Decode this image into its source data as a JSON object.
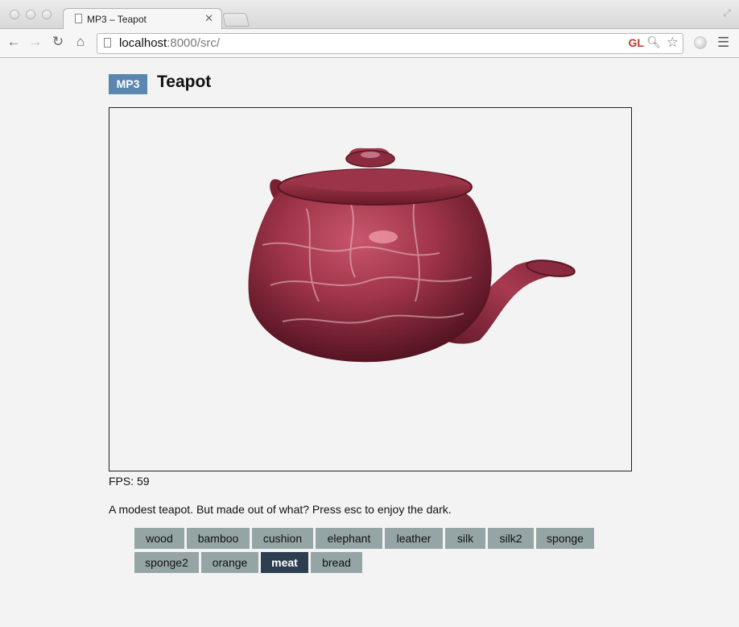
{
  "browser": {
    "tab_title": "MP3 – Teapot",
    "url_host": "localhost",
    "url_rest": ":8000/src/",
    "extension_badge": "GL"
  },
  "page": {
    "logo": "MP3",
    "title": "Teapot",
    "fps_label": "FPS: 59",
    "description": "A modest teapot. But made out of what? Press esc to enjoy the dark."
  },
  "materials": {
    "items": [
      "wood",
      "bamboo",
      "cushion",
      "elephant",
      "leather",
      "silk",
      "silk2",
      "sponge",
      "sponge2",
      "orange",
      "meat",
      "bread"
    ],
    "selected": "meat"
  },
  "colors": {
    "accent": "#5a86b0",
    "button": "#95a5a6",
    "button_active": "#2c3e50",
    "teapot": "#8e2a3c"
  }
}
